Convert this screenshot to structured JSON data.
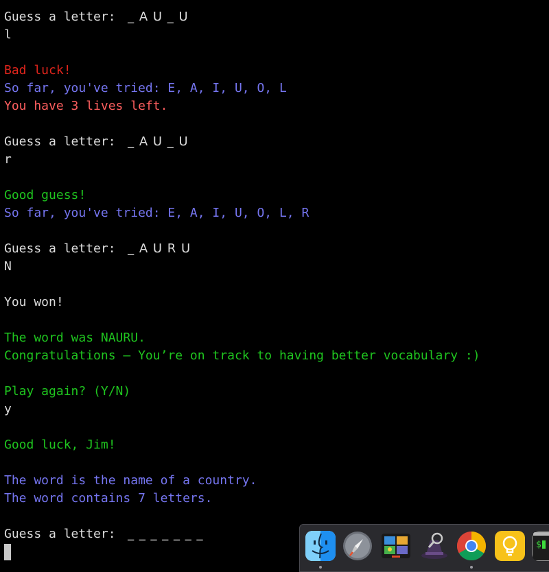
{
  "terminal": {
    "lines": [
      {
        "label": "Guess a letter: ",
        "word": " _ A U _ U"
      },
      {
        "text": "l"
      },
      {
        "text": "Bad luck!"
      },
      {
        "text": "So far, you've tried: E, A, I, U, O, L"
      },
      {
        "text": "You have 3 lives left."
      },
      {
        "label": "Guess a letter: ",
        "word": " _ A U _ U"
      },
      {
        "text": "r"
      },
      {
        "text": "Good guess!"
      },
      {
        "text": "So far, you've tried: E, A, I, U, O, L, R"
      },
      {
        "label": "Guess a letter: ",
        "word": " _ A U R U"
      },
      {
        "text": "N"
      },
      {
        "text": "You won!"
      },
      {
        "text": "The word was NAURU."
      },
      {
        "text": "Congratulations – You’re on track to having better vocabulary :)"
      },
      {
        "text": "Play again? (Y/N)"
      },
      {
        "text": "y"
      },
      {
        "text": "Good luck, Jim!"
      },
      {
        "text": "The word is the name of a country."
      },
      {
        "text": "The word contains 7 letters."
      },
      {
        "label": "Guess a letter: ",
        "word": " _ _ _ _ _ _ _"
      }
    ]
  },
  "colors": {
    "background": "#000000",
    "default_text": "#dcdcdc",
    "error_text": "#e0251c",
    "info_text": "#7575f0",
    "warning_text": "#ff5f5f",
    "success_text": "#1fc51f"
  },
  "dock": {
    "apps": [
      {
        "icon": "finder-icon",
        "running": true
      },
      {
        "icon": "launchpad-icon",
        "running": false
      },
      {
        "icon": "photo-slideshow-icon",
        "running": false
      },
      {
        "icon": "alfred-icon",
        "running": false
      },
      {
        "icon": "chrome-icon",
        "running": true
      },
      {
        "icon": "lightbulb-icon",
        "running": false
      },
      {
        "icon": "terminal-icon",
        "running": false
      }
    ]
  }
}
